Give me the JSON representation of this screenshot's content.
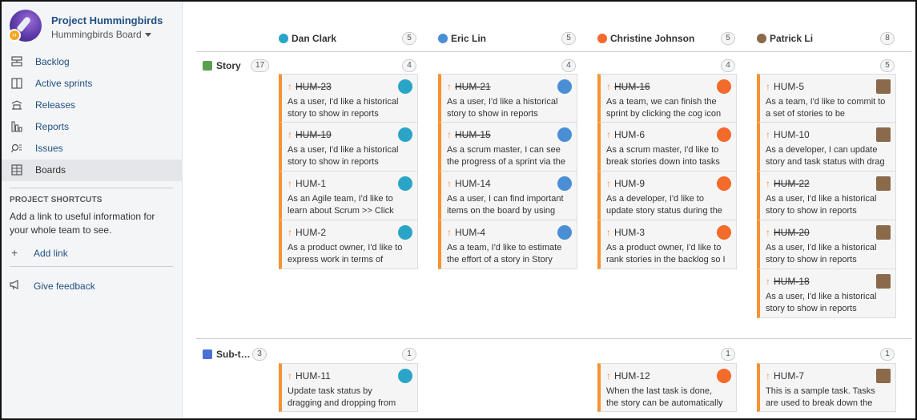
{
  "project": {
    "name": "Project Hummingbirds",
    "board": "Hummingbirds Board"
  },
  "nav": [
    {
      "label": "Backlog",
      "icon": "backlog-icon"
    },
    {
      "label": "Active sprints",
      "icon": "active-sprints-icon"
    },
    {
      "label": "Releases",
      "icon": "releases-icon"
    },
    {
      "label": "Reports",
      "icon": "reports-icon"
    },
    {
      "label": "Issues",
      "icon": "issues-icon"
    },
    {
      "label": "Boards",
      "icon": "boards-icon",
      "active": true
    }
  ],
  "shortcuts": {
    "title": "PROJECT SHORTCUTS",
    "text": "Add a link to useful information for your whole team to see.",
    "add_link": "Add link",
    "feedback": "Give feedback"
  },
  "columns": [
    {
      "name": "Dan Clark",
      "count": "5",
      "avatar_color": "#2aa5c8"
    },
    {
      "name": "Eric Lin",
      "count": "5",
      "avatar_color": "#4a8fd6"
    },
    {
      "name": "Christine Johnson",
      "count": "5",
      "avatar_color": "#f26b2b"
    },
    {
      "name": "Patrick Li",
      "count": "8",
      "avatar_color": "#8a6a4a"
    }
  ],
  "swimlanes": [
    {
      "name": "Story",
      "count": "17",
      "icon_color": "#59a14f",
      "column_counts": [
        "4",
        "4",
        "4",
        "5"
      ],
      "cards": [
        [
          {
            "key": "HUM-23",
            "done": true,
            "summary": "As a user, I'd like a historical story to show in reports"
          },
          {
            "key": "HUM-19",
            "done": true,
            "summary": "As a user, I'd like a historical story to show in reports"
          },
          {
            "key": "HUM-1",
            "done": false,
            "summary": "As an Agile team, I'd like to learn about Scrum >> Click the \"HUM-"
          },
          {
            "key": "HUM-2",
            "done": false,
            "summary": "As a product owner, I'd like to express work in terms of actual"
          }
        ],
        [
          {
            "key": "HUM-21",
            "done": true,
            "summary": "As a user, I'd like a historical story to show in reports"
          },
          {
            "key": "HUM-15",
            "done": true,
            "summary": "As a scrum master, I can see the progress of a sprint via the"
          },
          {
            "key": "HUM-14",
            "done": false,
            "summary": "As a user, I can find important items on the board by using the"
          },
          {
            "key": "HUM-4",
            "done": false,
            "summary": "As a team, I'd like to estimate the effort of a story in Story"
          }
        ],
        [
          {
            "key": "HUM-16",
            "done": true,
            "summary": "As a team, we can finish the sprint by clicking the cog icon"
          },
          {
            "key": "HUM-6",
            "done": false,
            "summary": "As a scrum master, I'd like to break stories down into tasks we"
          },
          {
            "key": "HUM-9",
            "done": false,
            "summary": "As a developer, I'd like to update story status during the sprint >>"
          },
          {
            "key": "HUM-3",
            "done": false,
            "summary": "As a product owner, I'd like to rank stories in the backlog so I"
          }
        ],
        [
          {
            "key": "HUM-5",
            "done": false,
            "summary": "As a team, I'd like to commit to a set of stories to be completed in"
          },
          {
            "key": "HUM-10",
            "done": false,
            "summary": "As a developer, I can update story and task status with drag"
          },
          {
            "key": "HUM-22",
            "done": true,
            "summary": "As a user, I'd like a historical story to show in reports"
          },
          {
            "key": "HUM-20",
            "done": true,
            "summary": "As a user, I'd like a historical story to show in reports"
          },
          {
            "key": "HUM-18",
            "done": true,
            "summary": "As a user, I'd like a historical story to show in reports"
          }
        ]
      ]
    },
    {
      "name": "Sub-t…",
      "count": "3",
      "icon_color": "#4a6fd6",
      "column_counts": [
        "1",
        "",
        "1",
        "1"
      ],
      "cards": [
        [
          {
            "key": "HUM-11",
            "done": false,
            "summary": "Update task status by dragging and dropping from column to"
          }
        ],
        [],
        [
          {
            "key": "HUM-12",
            "done": false,
            "summary": "When the last task is done, the story can be automatically"
          }
        ],
        [
          {
            "key": "HUM-7",
            "done": false,
            "summary": "This is a sample task. Tasks are used to break down the steps to"
          }
        ]
      ]
    }
  ]
}
